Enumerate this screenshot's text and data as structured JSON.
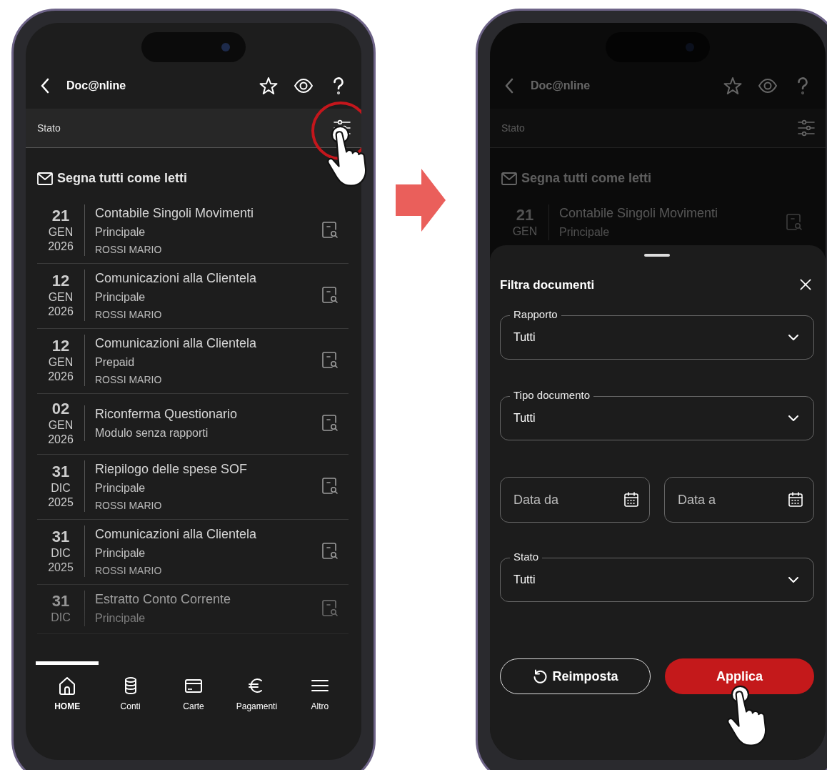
{
  "phones": [
    {
      "dimmed": false,
      "header": {
        "title": "Doc@nline"
      },
      "filter_bar": {
        "label": "Stato",
        "highlighted": true
      },
      "mark_all": "Segna tutti come letti",
      "documents": [
        {
          "day": "21",
          "month": "GEN",
          "year": "2026",
          "title": "Contabile Singoli Movimenti",
          "account": "Principale",
          "holder": "ROSSI MARIO"
        },
        {
          "day": "12",
          "month": "GEN",
          "year": "2026",
          "title": "Comunicazioni alla Clientela",
          "account": "Principale",
          "holder": "ROSSI MARIO"
        },
        {
          "day": "12",
          "month": "GEN",
          "year": "2026",
          "title": "Comunicazioni alla Clientela",
          "account": "Prepaid",
          "holder": "ROSSI MARIO"
        },
        {
          "day": "02",
          "month": "GEN",
          "year": "2026",
          "title": "Riconferma Questionario",
          "account": "Modulo senza rapporti"
        },
        {
          "day": "31",
          "month": "DIC",
          "year": "2025",
          "title": "Riepilogo delle spese SOF",
          "account": "Principale",
          "holder": "ROSSI MARIO"
        },
        {
          "day": "31",
          "month": "DIC",
          "year": "2025",
          "title": "Comunicazioni alla Clientela",
          "account": "Principale",
          "holder": "ROSSI MARIO"
        },
        {
          "day": "31",
          "month": "DIC",
          "title": "Estratto Conto Corrente",
          "account": "Principale"
        }
      ],
      "bottom_nav": [
        {
          "label": "HOME",
          "selected": true
        },
        {
          "label": "Conti",
          "selected": false
        },
        {
          "label": "Carte",
          "selected": false
        },
        {
          "label": "Pagamenti",
          "selected": false
        },
        {
          "label": "Altro",
          "selected": false
        }
      ]
    },
    {
      "dimmed": true,
      "header": {
        "title": "Doc@nline"
      },
      "filter_bar": {
        "label": "Stato",
        "highlighted": false
      },
      "mark_all": "Segna tutti come letti",
      "documents": [
        {
          "day": "21",
          "month": "GEN",
          "title": "Contabile Singoli Movimenti",
          "account": "Principale"
        }
      ],
      "filter_sheet": {
        "title": "Filtra documenti",
        "fields": [
          {
            "kind": "select",
            "label": "Rapporto",
            "value": "Tutti"
          },
          {
            "kind": "select",
            "label": "Tipo documento",
            "value": "Tutti"
          },
          {
            "kind": "date_range",
            "from": {
              "placeholder": "Data da"
            },
            "to": {
              "placeholder": "Data a"
            }
          },
          {
            "kind": "select",
            "label": "Stato",
            "value": "Tutti"
          }
        ],
        "buttons": [
          {
            "label": "Reimposta",
            "kind": "reset",
            "pressed": false
          },
          {
            "label": "Applica",
            "kind": "primary",
            "pressed": true
          }
        ]
      }
    }
  ]
}
